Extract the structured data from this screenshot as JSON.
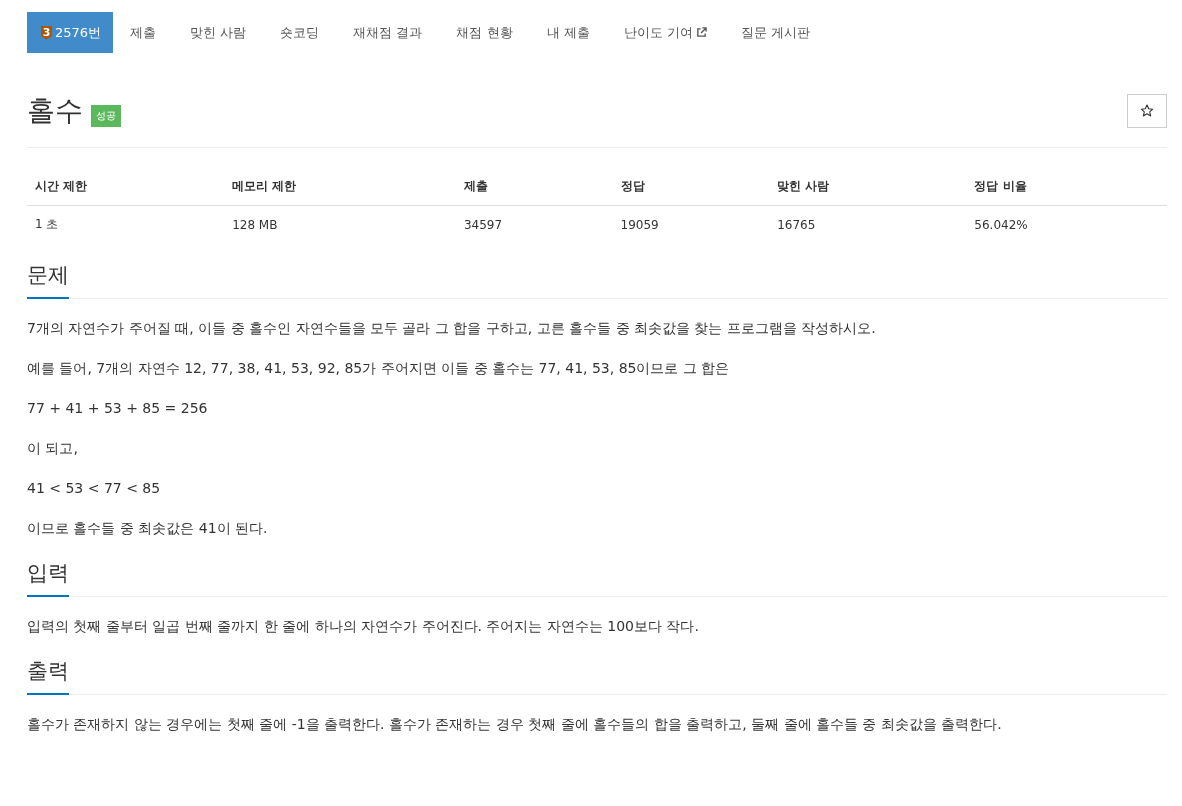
{
  "tabs": [
    {
      "label": "2576번",
      "tier": "3",
      "kind": "problem",
      "selected": true
    },
    {
      "label": "제출",
      "kind": "plain",
      "selected": false
    },
    {
      "label": "맞힌 사람",
      "kind": "plain",
      "selected": false
    },
    {
      "label": "숏코딩",
      "kind": "plain",
      "selected": false
    },
    {
      "label": "재채점 결과",
      "kind": "plain",
      "selected": false
    },
    {
      "label": "채점 현황",
      "kind": "plain",
      "selected": false
    },
    {
      "label": "내 제출",
      "kind": "plain",
      "selected": false
    },
    {
      "label": "난이도 기여",
      "kind": "external",
      "selected": false
    },
    {
      "label": "질문 게시판",
      "kind": "plain",
      "selected": false
    }
  ],
  "title": "홀수",
  "status_badge": "성공",
  "info_table": {
    "columns": [
      "시간 제한",
      "메모리 제한",
      "제출",
      "정답",
      "맞힌 사람",
      "정답 비율"
    ],
    "rows": [
      [
        "1 초",
        "128 MB",
        "34597",
        "19059",
        "16765",
        "56.042%"
      ]
    ]
  },
  "sections": [
    {
      "heading": "문제",
      "paragraphs": [
        "7개의 자연수가 주어질 때, 이들 중 홀수인 자연수들을 모두 골라 그 합을 구하고, 고른 홀수들 중 최솟값을 찾는 프로그램을 작성하시오.",
        "예를 들어, 7개의 자연수 12, 77, 38, 41, 53, 92, 85가 주어지면 이들 중 홀수는 77, 41, 53, 85이므로 그 합은",
        "77 + 41 + 53 + 85 = 256",
        "이 되고,",
        "41 < 53 < 77 < 85",
        "이므로 홀수들 중 최솟값은 41이 된다."
      ]
    },
    {
      "heading": "입력",
      "paragraphs": [
        "입력의 첫째 줄부터 일곱 번째 줄까지 한 줄에 하나의 자연수가 주어진다. 주어지는 자연수는 100보다 작다."
      ]
    },
    {
      "heading": "출력",
      "paragraphs": [
        "홀수가 존재하지 않는 경우에는 첫째 줄에 -1을 출력한다. 홀수가 존재하는 경우 첫째 줄에 홀수들의 합을 출력하고, 둘째 줄에 홀수들 중 최솟값을 출력한다."
      ]
    }
  ]
}
